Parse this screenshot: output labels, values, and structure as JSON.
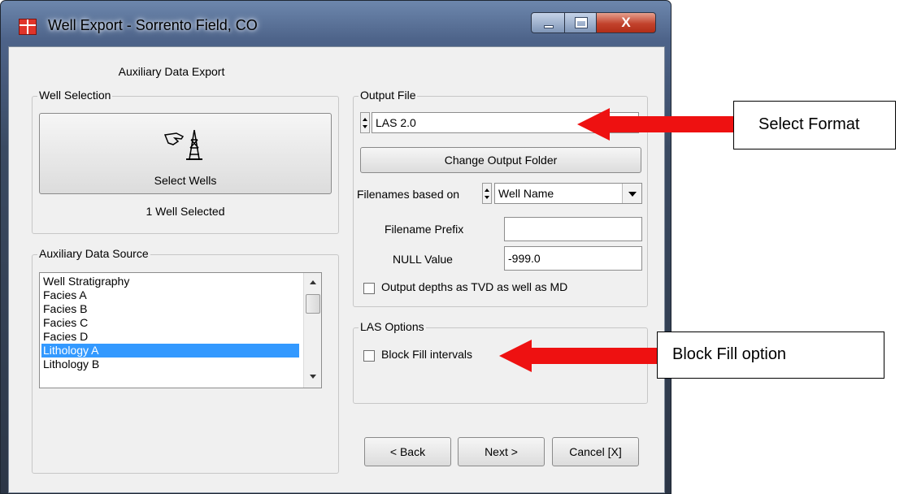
{
  "window": {
    "title": "Well Export - Sorrento Field, CO",
    "close_glyph": "X"
  },
  "dialog": {
    "heading": "Auxiliary Data Export"
  },
  "well_selection": {
    "legend": "Well Selection",
    "select_button_label": "Select Wells",
    "status": "1 Well Selected",
    "icon": "hand-pointing-derrick-icon"
  },
  "aux_source": {
    "legend": "Auxiliary Data Source",
    "items": [
      "Well Stratigraphy",
      "Facies A",
      "Facies B",
      "Facies C",
      "Facies D",
      "Lithology A",
      "Lithology B"
    ],
    "selected": "Lithology A"
  },
  "output_file": {
    "legend": "Output File",
    "format_value": "LAS 2.0",
    "change_folder_label": "Change Output Folder",
    "filenames_label": "Filenames based on",
    "filenames_value": "Well Name",
    "prefix_label": "Filename Prefix",
    "prefix_value": "",
    "null_label": "NULL Value",
    "null_value": "-999.0",
    "tvd_label": "Output depths as TVD as well as MD",
    "tvd_checked": false
  },
  "las_options": {
    "legend": "LAS Options",
    "block_fill_label": "Block Fill intervals",
    "block_fill_checked": false
  },
  "footer": {
    "back_label": "< Back",
    "next_label": "Next >",
    "cancel_label": "Cancel [X]"
  },
  "annotations": {
    "select_format": "Select Format",
    "block_fill_option": "Block Fill option",
    "arrow_color": "#ee1111"
  }
}
